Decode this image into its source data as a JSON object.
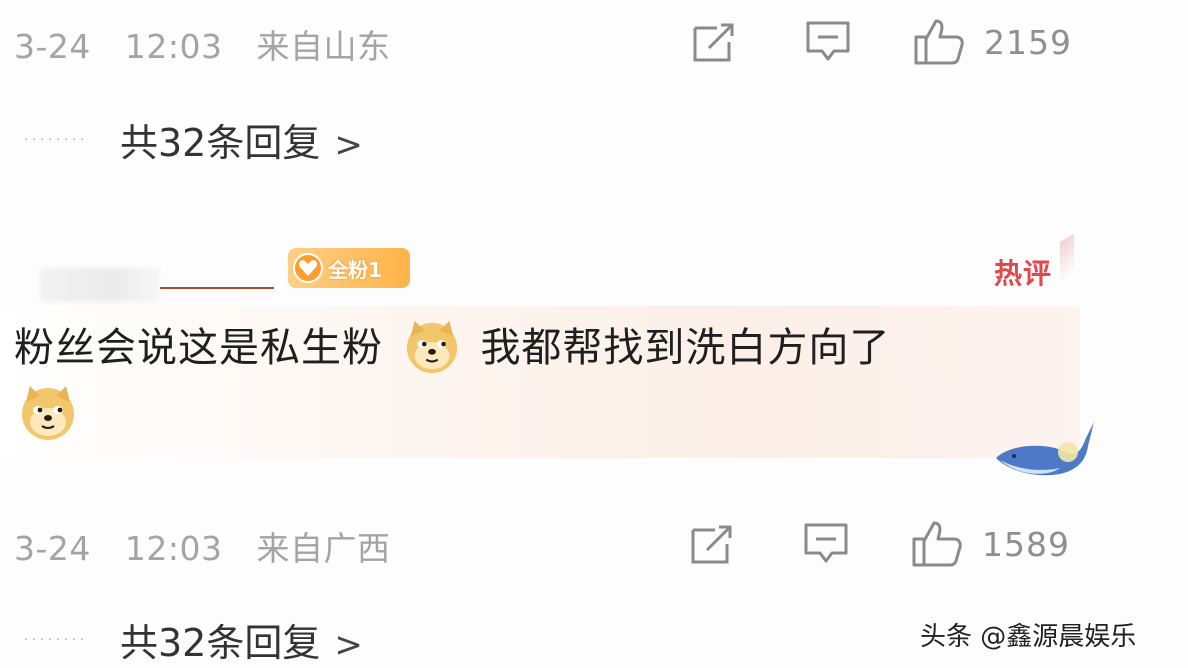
{
  "comment_top": {
    "date": "3-24",
    "time": "12:03",
    "location": "来自山东",
    "like_count": "2159",
    "replies_label": "共32条回复",
    "replies_chevron": ">"
  },
  "comment_main": {
    "fan_badge": "全粉1",
    "hot_tag": "热评",
    "text_part1": "粉丝会说这是私生粉",
    "text_part2": "我都帮找到洗白方向了",
    "emoji": "doge-icon",
    "date": "3-24",
    "time": "12:03",
    "location": "来自广西",
    "like_count": "1589",
    "replies_label": "共32条回复",
    "replies_chevron": ">"
  },
  "watermark": "头条 @鑫源晨娱乐",
  "colors": {
    "meta_gray": "#a4a4a4",
    "hot_red": "#e4474b",
    "badge_orange": "#ffb347",
    "bubble_pink": "#fcefe8"
  }
}
